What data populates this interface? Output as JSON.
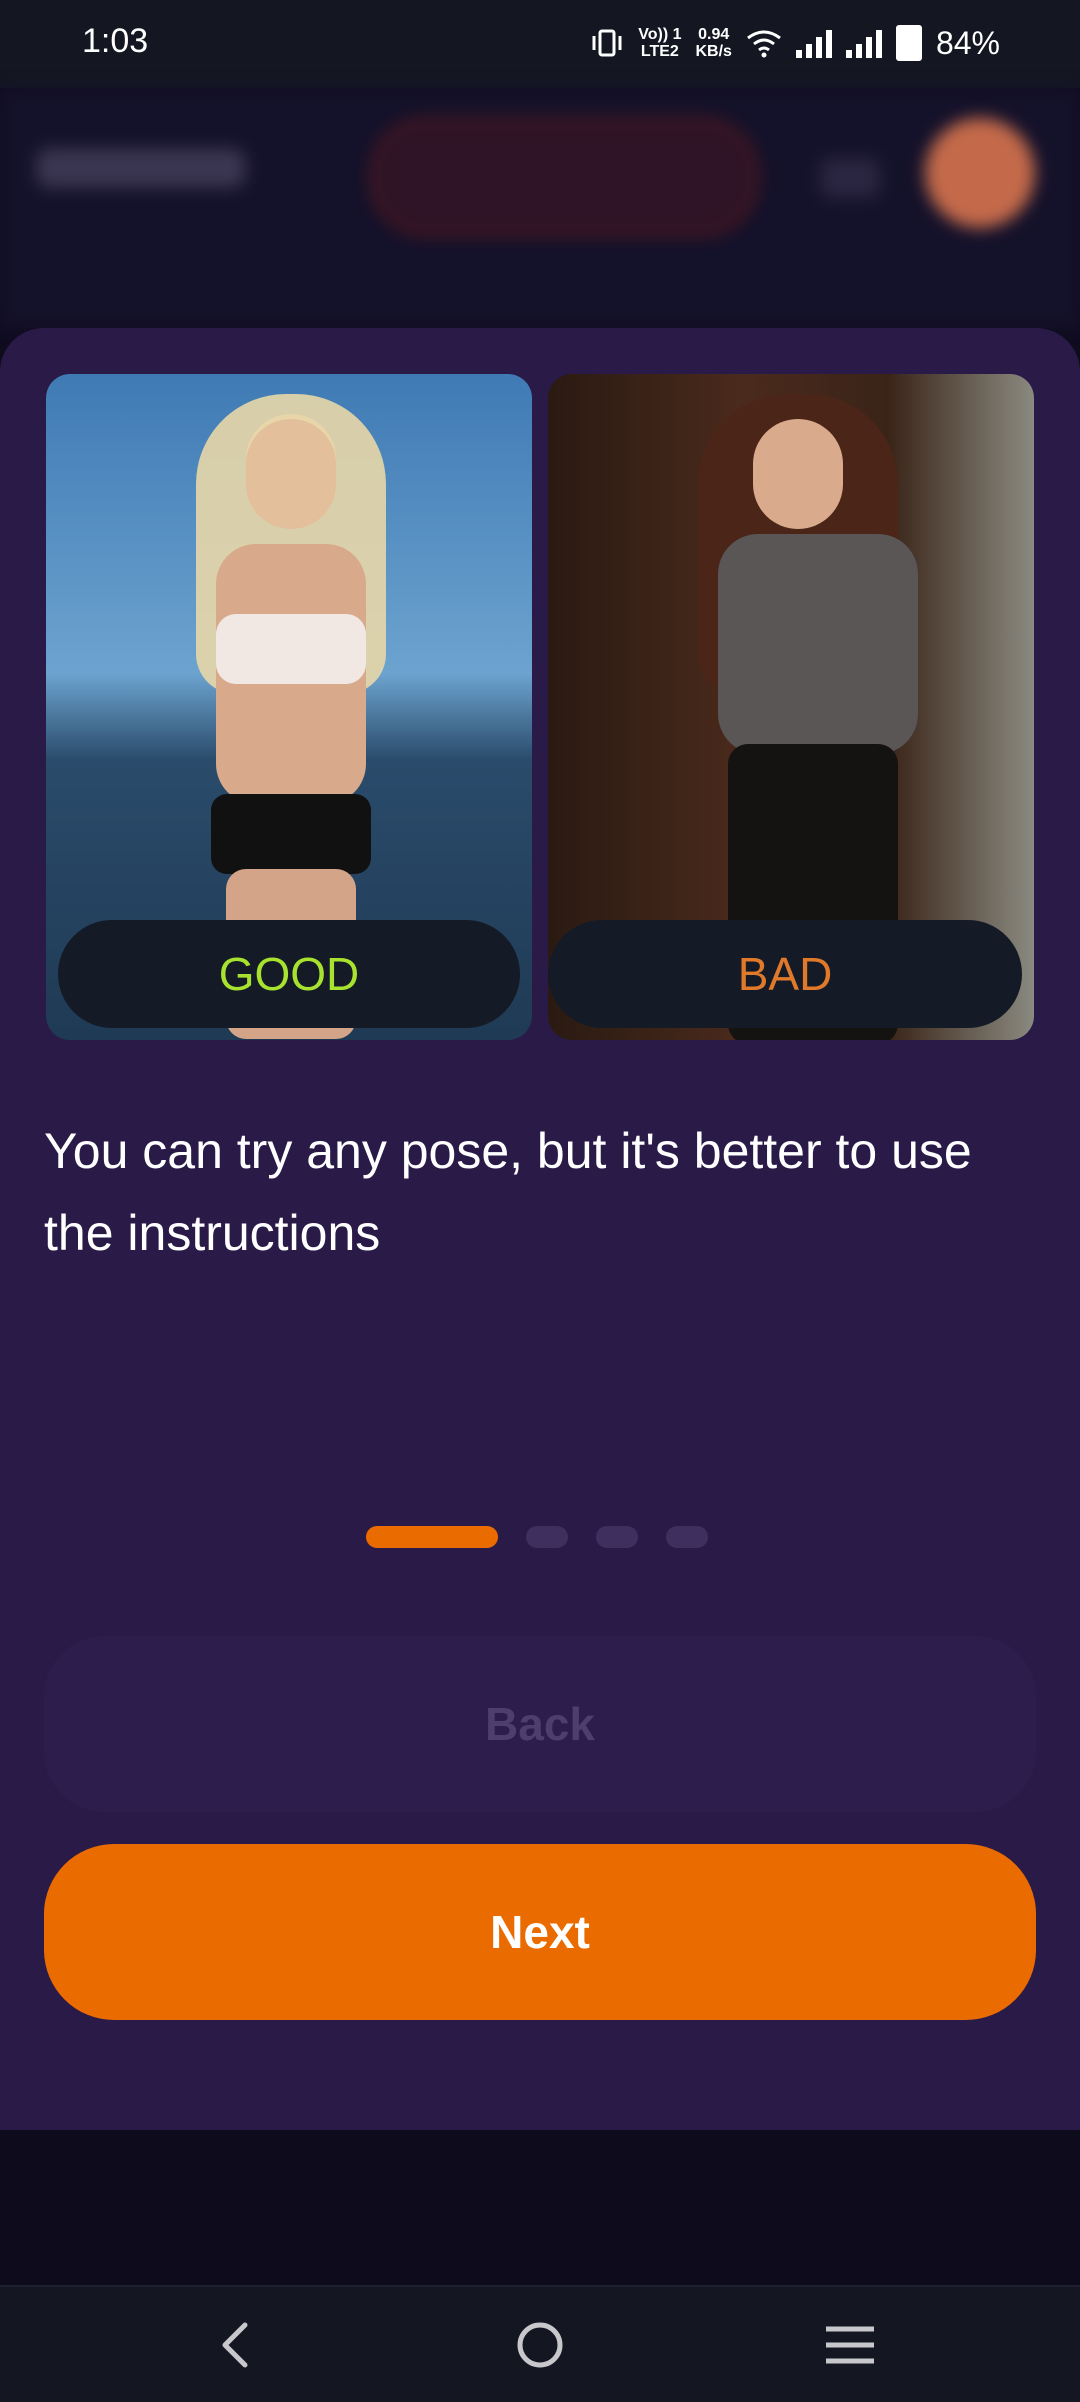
{
  "status_bar": {
    "time": "1:03",
    "network_top": "Vo)) 1",
    "network_bottom": "LTE2",
    "speed_top": "0.94",
    "speed_bottom": "KB/s",
    "battery": "84%"
  },
  "instruction": {
    "good_label": "GOOD",
    "bad_label": "BAD",
    "description": "You can try any pose, but it's better to use the instructions",
    "page_indicator": {
      "total": 4,
      "current": 1
    }
  },
  "buttons": {
    "back_label": "Back",
    "next_label": "Next"
  },
  "colors": {
    "accent": "#ea6c00",
    "good": "#a6e22e",
    "bad": "#e07a2a"
  }
}
